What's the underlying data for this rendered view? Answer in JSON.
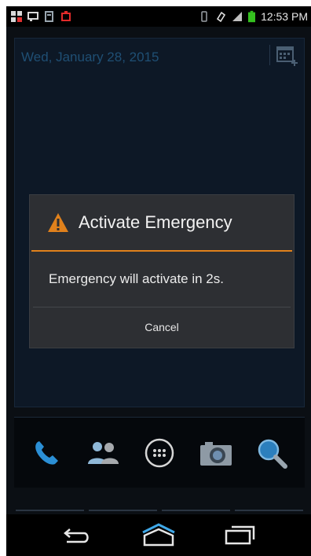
{
  "status_bar": {
    "time": "12:53 PM",
    "left_icons": [
      "app-grid-icon",
      "chat-icon",
      "media-icon",
      "alert-icon"
    ],
    "right_icons": [
      "vibrate-icon",
      "sync-icon",
      "signal-icon",
      "battery-icon"
    ]
  },
  "home": {
    "date": "Wed, January 28, 2015",
    "calendar_icon": "calendar-add-icon"
  },
  "dock": {
    "items": [
      "phone-icon",
      "contacts-icon",
      "apps-icon",
      "camera-icon",
      "search-icon"
    ]
  },
  "dialog": {
    "icon": "warning-icon",
    "title": "Activate Emergency",
    "message": "Emergency will activate in 2s.",
    "cancel_label": "Cancel",
    "accent_color": "#e0811c"
  },
  "nav_bar": {
    "items": [
      "back-icon",
      "home-icon",
      "recent-apps-icon"
    ]
  }
}
